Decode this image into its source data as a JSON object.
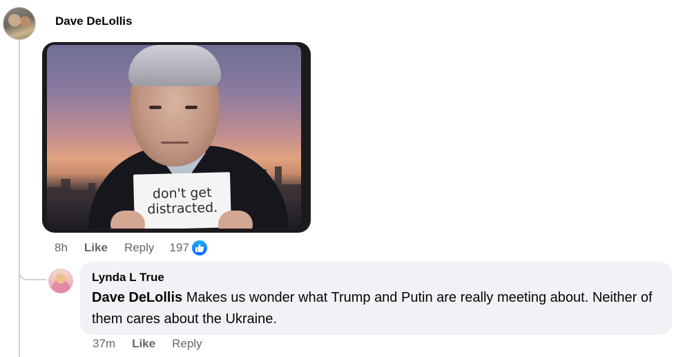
{
  "comment": {
    "author": "Dave DeLollis",
    "image": {
      "sign_line_1": "don't get",
      "sign_line_2": "distracted."
    },
    "actions": {
      "time": "8h",
      "like": "Like",
      "reply": "Reply",
      "reaction_count": "197",
      "reaction_icon": "thumbs-up-icon"
    }
  },
  "reply": {
    "author": "Lynda L True",
    "mention": "Dave DeLollis",
    "text": " Makes us wonder what Trump and Putin are really meeting about. Neither of them cares about the Ukraine.",
    "actions": {
      "time": "37m",
      "like": "Like",
      "reply": "Reply"
    }
  },
  "colors": {
    "meta_text": "#65676b",
    "bubble_bg": "#f0f2f5",
    "like_blue": "#0866ff",
    "thread_line": "#ced0d4"
  }
}
